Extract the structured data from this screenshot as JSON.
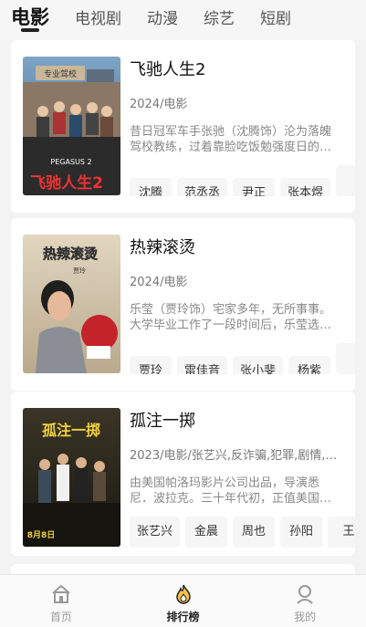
{
  "tabs": [
    "电影",
    "电视剧",
    "动漫",
    "综艺",
    "短剧"
  ],
  "movies": [
    {
      "title": "飞驰人生2",
      "meta": "2024/电影",
      "desc": "昔日冠军车手张驰（沈腾饰）沦为落魄驾校教练，过着靠脸吃饭勉强度日的…",
      "actors": [
        "沈腾",
        "范丞丞",
        "尹正",
        "张本煜",
        ""
      ],
      "poster": {
        "tagline": "PEGASUS 2",
        "sign": "专业驾校",
        "title": "飞驰人生2",
        "colors": [
          "#6b93b8",
          "#3b5a7a"
        ]
      }
    },
    {
      "title": "热辣滚烫",
      "meta": "2024/电影",
      "desc": "乐莹（贾玲饰）宅家多年，无所事事。大学毕业工作了一段时间后，乐莹选…",
      "actors": [
        "贾玲",
        "雷佳音",
        "张小斐",
        "杨紫",
        ""
      ],
      "poster": {
        "tagline": "贾玲",
        "title": "热辣滚烫",
        "colors": [
          "#d9ccb6",
          "#a08d70"
        ]
      }
    },
    {
      "title": "孤注一掷",
      "meta": "2023/电影/张艺兴,反诈骗,犯罪,剧情,…",
      "desc": "由美国帕洛玛影片公司出品，导演悉尼．波拉克。三十年代初，正值美国…",
      "actors": [
        "张艺兴",
        "金晨",
        "周也",
        "孙阳",
        "王"
      ],
      "poster": {
        "tagline": "8月8日",
        "title": "孤注一掷",
        "colors": [
          "#2f2b1e",
          "#1a1812"
        ]
      }
    },
    {
      "title": "",
      "meta": "",
      "desc": "",
      "actors": [],
      "poster": null
    }
  ],
  "bottom_nav": [
    {
      "label": "首页",
      "icon": "home-icon"
    },
    {
      "label": "排行榜",
      "icon": "flame-icon"
    },
    {
      "label": "我的",
      "icon": "profile-icon"
    }
  ]
}
